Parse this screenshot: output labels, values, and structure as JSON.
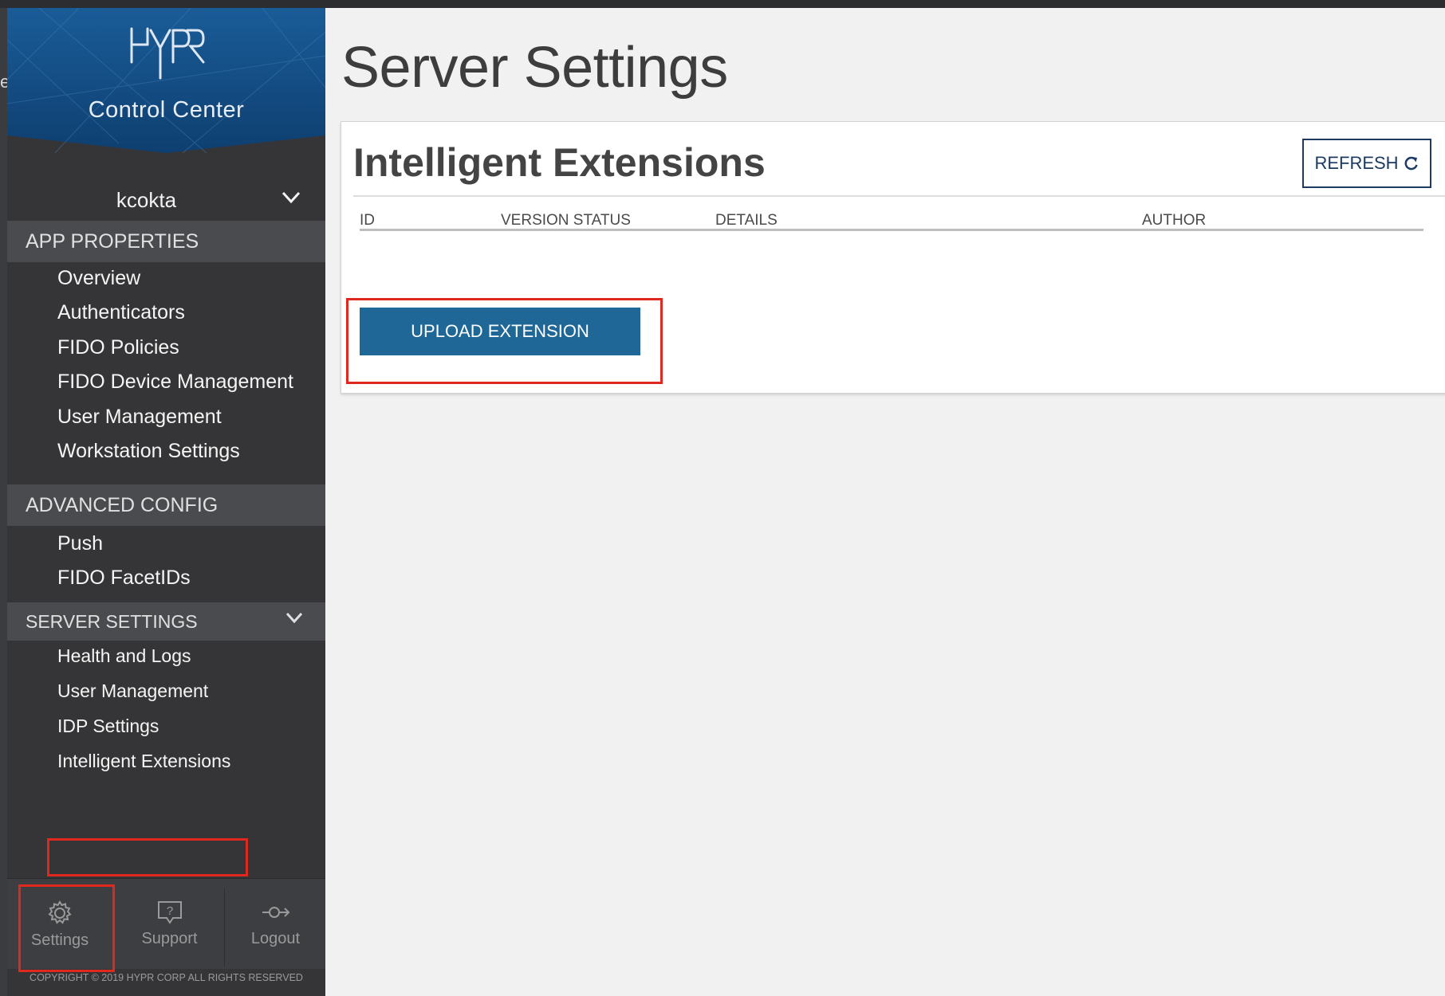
{
  "sidebar": {
    "logo_text": "HYPR",
    "logo_subtitle": "Control Center",
    "username": "kcokta",
    "sections": [
      {
        "header": "APP PROPERTIES",
        "items": [
          "Overview",
          "Authenticators",
          "FIDO Policies",
          "FIDO Device Management",
          "User Management",
          "Workstation Settings"
        ]
      },
      {
        "header": "ADVANCED CONFIG",
        "items": [
          "Push",
          "FIDO FacetIDs"
        ]
      },
      {
        "header": "SERVER SETTINGS",
        "items": [
          "Health and Logs",
          "User Management",
          "IDP Settings",
          "Intelligent Extensions"
        ]
      }
    ],
    "footer": {
      "settings": "Settings",
      "support": "Support",
      "logout": "Logout"
    },
    "copyright": "COPYRIGHT © 2019 HYPR CORP ALL RIGHTS RESERVED"
  },
  "main": {
    "title": "Server Settings",
    "card": {
      "title": "Intelligent Extensions",
      "refresh_label": "REFRESH",
      "columns": [
        "ID",
        "VERSION STATUS",
        "DETAILS",
        "AUTHOR"
      ],
      "upload_label": "UPLOAD EXTENSION"
    }
  },
  "colors": {
    "accent": "#1e6796",
    "highlight": "#e0281e",
    "sidebar_bg": "#353537",
    "section_bg": "#4a4b4e",
    "logo_bg": "#1b5f99"
  }
}
